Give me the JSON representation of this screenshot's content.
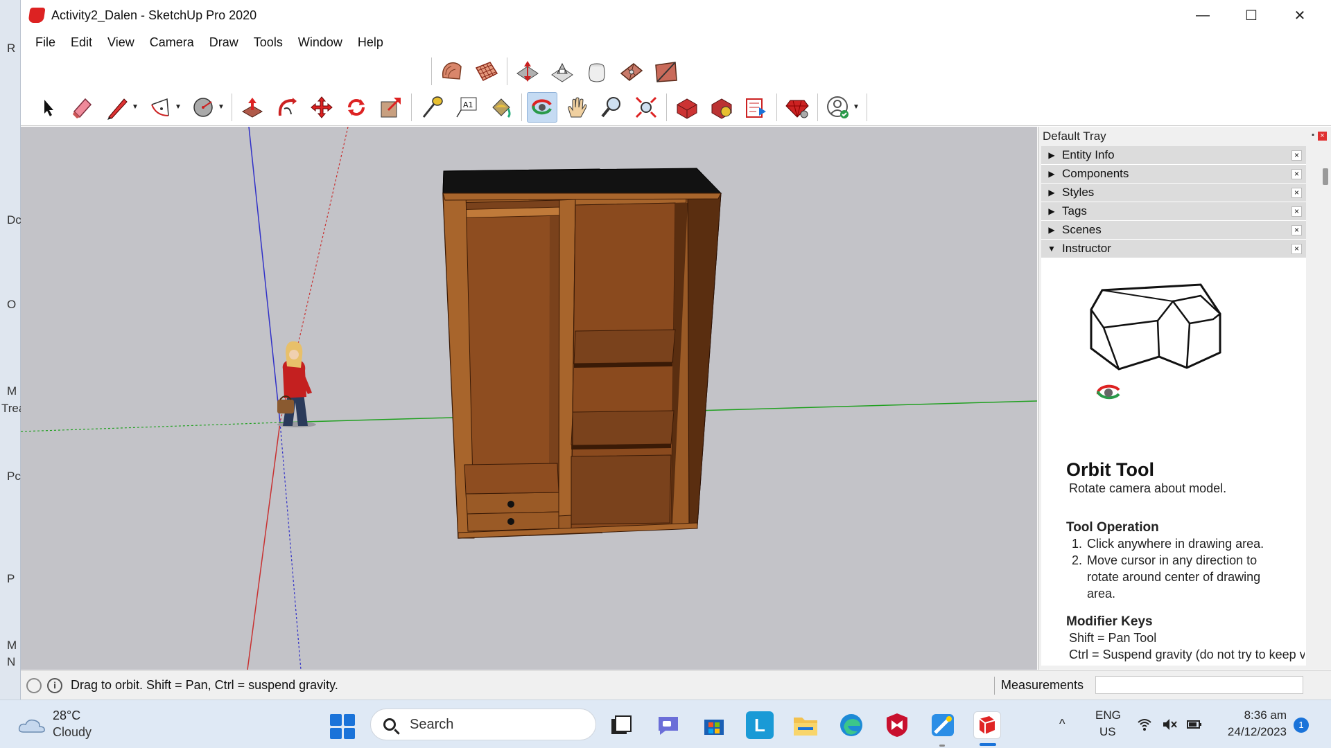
{
  "window": {
    "title": "Activity2_Dalen - SketchUp Pro 2020",
    "minimize": "—",
    "maximize": "☐",
    "close": "✕"
  },
  "background_window_letters": [
    "R",
    "Dc",
    "O",
    "M",
    "Trea",
    "Pc",
    "P",
    "M",
    "N"
  ],
  "menu": [
    "File",
    "Edit",
    "View",
    "Camera",
    "Draw",
    "Tools",
    "Window",
    "Help"
  ],
  "toolbar_top": {
    "icons": [
      "sandbox-from-contours-icon",
      "sandbox-from-scratch-icon",
      "smoove-icon",
      "stamp-icon",
      "drape-icon",
      "add-detail-icon",
      "flip-edge-icon"
    ]
  },
  "toolbar_main": {
    "active_tool": "orbit",
    "tools": [
      "select",
      "eraser",
      "line",
      "arc",
      "circle",
      "push-pull",
      "follow-me",
      "move",
      "rotate",
      "scale",
      "tape-measure",
      "text",
      "paint-bucket",
      "orbit",
      "pan",
      "zoom",
      "zoom-extents",
      "3d-warehouse",
      "extension-warehouse",
      "layout",
      "extension-manager",
      "account"
    ]
  },
  "tray": {
    "title": "Default Tray",
    "pin": "▪",
    "close": "×",
    "panels": [
      {
        "label": "Entity Info",
        "expanded": false
      },
      {
        "label": "Components",
        "expanded": false
      },
      {
        "label": "Styles",
        "expanded": false
      },
      {
        "label": "Tags",
        "expanded": false
      },
      {
        "label": "Scenes",
        "expanded": false
      },
      {
        "label": "Instructor",
        "expanded": true
      }
    ],
    "arrow_collapsed": "▶",
    "arrow_expanded": "▼",
    "panel_close": "×",
    "instructor": {
      "tool_name": "Orbit Tool",
      "description": "Rotate camera about model.",
      "operation_heading": "Tool Operation",
      "steps": [
        {
          "num": "1.",
          "text": "Click anywhere in drawing area."
        },
        {
          "num": "2.",
          "text": "Move cursor in any direction to rotate around center of drawing area."
        }
      ],
      "modifier_heading": "Modifier Keys",
      "modifiers": [
        "Shift = Pan Tool",
        "Ctrl = Suspend gravity (do not try to keep vertical edges up and"
      ]
    }
  },
  "status": {
    "text": "Drag to orbit. Shift = Pan, Ctrl = suspend gravity.",
    "info_icon": "i",
    "measurements_label": "Measurements",
    "measurements_value": ""
  },
  "taskbar": {
    "weather_temp": "28°C",
    "weather_desc": "Cloudy",
    "search_placeholder": "Search",
    "language_top": "ENG",
    "language_bottom": "US",
    "time": "8:36 am",
    "date": "24/12/2023",
    "notification_count": "1",
    "tray_chevron": "^",
    "apps": [
      "task-view",
      "teams-chat",
      "microsoft-store",
      "l-app",
      "file-explorer",
      "edge",
      "mcafee",
      "paint",
      "sketchup"
    ]
  },
  "colors": {
    "viewport_bg": "#c3c3c8",
    "wood": "#9a5a26",
    "wood_dark": "#5f3413",
    "axis_blue": "#3030c8",
    "axis_red": "#c83030",
    "axis_green": "#20a020",
    "accent": "#1a73d9"
  }
}
